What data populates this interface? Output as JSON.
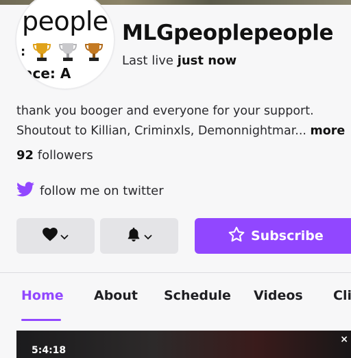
{
  "channel": {
    "name": "MLGpeoplepeople",
    "last_live_prefix": "Last live",
    "last_live_value": "just now"
  },
  "avatar": {
    "word": "people",
    "trophy_labels": [
      "1ST PLACE",
      "2ND PLACE",
      "3RD PLACE"
    ],
    "cut_text": "ace: A"
  },
  "bio": {
    "text": "thank you booger and everyone for your support. Shoutout to Killian, Criminxls, Demonnightmar...",
    "more_label": "more"
  },
  "followers": {
    "count": "92",
    "label": "followers"
  },
  "social": {
    "label": "follow me on twitter",
    "icon": "twitter-bird-icon"
  },
  "actions": {
    "follow_icon": "heart-icon",
    "notify_icon": "bell-icon",
    "subscribe_label": "Subscribe"
  },
  "tabs": [
    {
      "label": "Home",
      "active": true
    },
    {
      "label": "About",
      "active": false
    },
    {
      "label": "Schedule",
      "active": false
    },
    {
      "label": "Videos",
      "active": false
    },
    {
      "label": "Cli",
      "active": false
    }
  ],
  "video": {
    "timestamp": "5:4:18",
    "close_label": "×"
  },
  "colors": {
    "accent": "#9147ff",
    "twitter": "#9147ff",
    "button_gray": "#e4e4e7"
  }
}
